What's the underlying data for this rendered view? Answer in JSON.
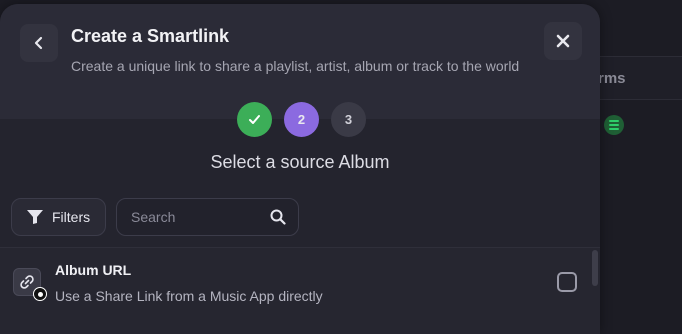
{
  "background": {
    "column_header": "rms"
  },
  "modal": {
    "title": "Create a Smartlink",
    "subtitle": "Create a unique link to share a playlist, artist, album or track to the world",
    "steps": [
      {
        "label": "",
        "state": "done"
      },
      {
        "label": "2",
        "state": "active"
      },
      {
        "label": "3",
        "state": "pending"
      }
    ],
    "section_title": "Select a source Album",
    "filters_label": "Filters",
    "search": {
      "placeholder": "Search",
      "value": ""
    },
    "list": [
      {
        "title": "Album URL",
        "description": "Use a Share Link from a Music App directly",
        "checked": false
      }
    ]
  },
  "colors": {
    "step_done": "#3cae58",
    "step_active": "#8b6ae0",
    "step_pending": "#3a3a46",
    "modal_bg": "#24242e"
  }
}
